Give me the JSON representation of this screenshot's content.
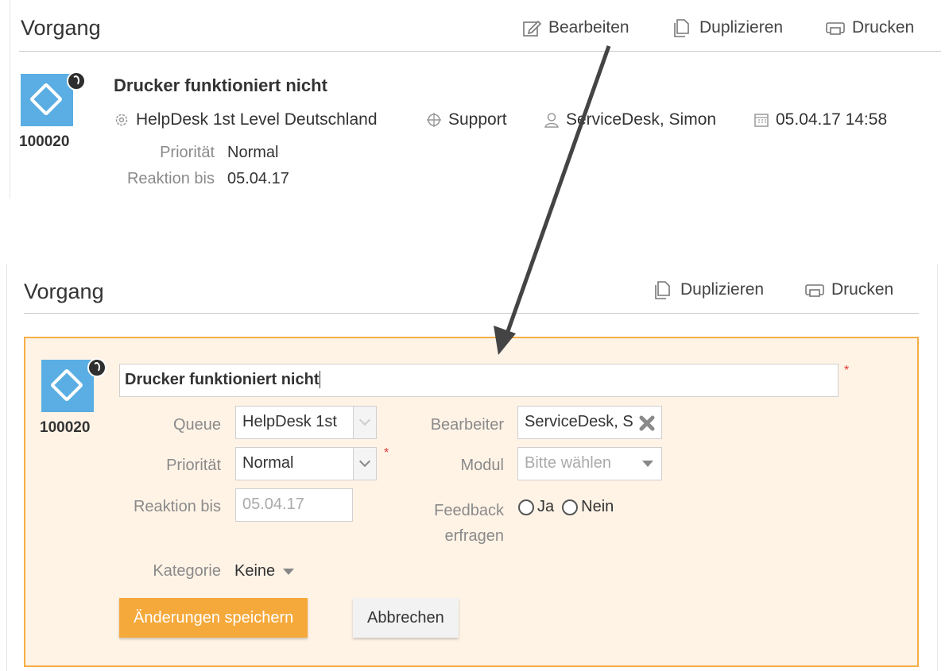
{
  "top": {
    "title": "Vorgang",
    "toolbar": {
      "edit_label": "Bearbeiten",
      "duplicate_label": "Duplizieren",
      "print_label": "Drucken"
    },
    "case": {
      "id": "100020",
      "title": "Drucker funktioniert nicht",
      "queue": "HelpDesk 1st Level Deutschland",
      "module": "Support",
      "assignee": "ServiceDesk, Simon",
      "datetime": "05.04.17 14:58",
      "priority_label": "Priorität",
      "priority_value": "Normal",
      "reaction_label": "Reaktion bis",
      "reaction_value": "05.04.17"
    }
  },
  "bottom": {
    "title": "Vorgang",
    "toolbar": {
      "duplicate_label": "Duplizieren",
      "print_label": "Drucken"
    },
    "form": {
      "case_id": "100020",
      "title_value": "Drucker funktioniert nicht",
      "queue_label": "Queue",
      "queue_value": "HelpDesk 1st",
      "priority_label": "Priorität",
      "priority_value": "Normal",
      "reaction_label": "Reaktion bis",
      "reaction_value": "05.04.17",
      "assignee_label": "Bearbeiter",
      "assignee_value": "ServiceDesk, S",
      "module_label": "Modul",
      "module_placeholder": "Bitte wählen",
      "feedback_label_line1": "Feedback",
      "feedback_label_line2": "erfragen",
      "feedback_yes": "Ja",
      "feedback_no": "Nein",
      "category_label": "Kategorie",
      "category_value": "Keine",
      "save_label": "Änderungen speichern",
      "cancel_label": "Abbrechen",
      "required_mark": "*"
    }
  },
  "colors": {
    "accent": "#f5a93b",
    "edit_bg": "#fff3e6",
    "edit_border": "#f5ae45",
    "icon_blue": "#5aaee3",
    "arrow": "#444444"
  }
}
